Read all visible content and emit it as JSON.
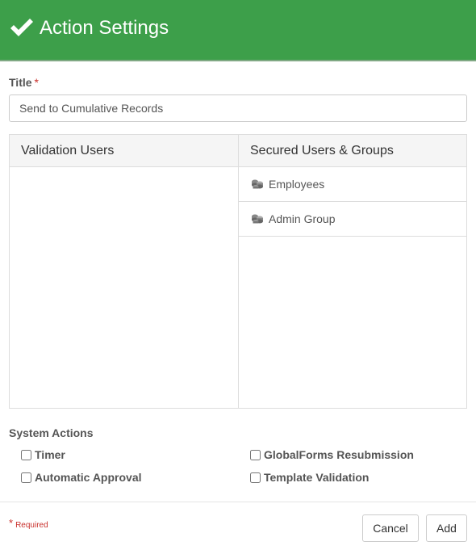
{
  "header": {
    "title": "Action Settings",
    "icon": "checkmark-icon",
    "color": "#3d9f4a"
  },
  "title_field": {
    "label": "Title",
    "required_mark": "*",
    "value": "Send to Cumulative Records"
  },
  "validation_users": {
    "heading": "Validation Users",
    "items": []
  },
  "secured_users": {
    "heading": "Secured Users & Groups",
    "items": [
      {
        "label": "Employees",
        "icon": "group-icon"
      },
      {
        "label": "Admin Group",
        "icon": "group-icon"
      }
    ]
  },
  "system_actions": {
    "label": "System Actions",
    "options": [
      {
        "label": "Timer",
        "checked": false
      },
      {
        "label": "GlobalForms Resubmission",
        "checked": false
      },
      {
        "label": "Automatic Approval",
        "checked": false
      },
      {
        "label": "Template Validation",
        "checked": false
      }
    ]
  },
  "footer": {
    "required_star": "*",
    "required_text": "Required",
    "cancel_label": "Cancel",
    "add_label": "Add"
  }
}
